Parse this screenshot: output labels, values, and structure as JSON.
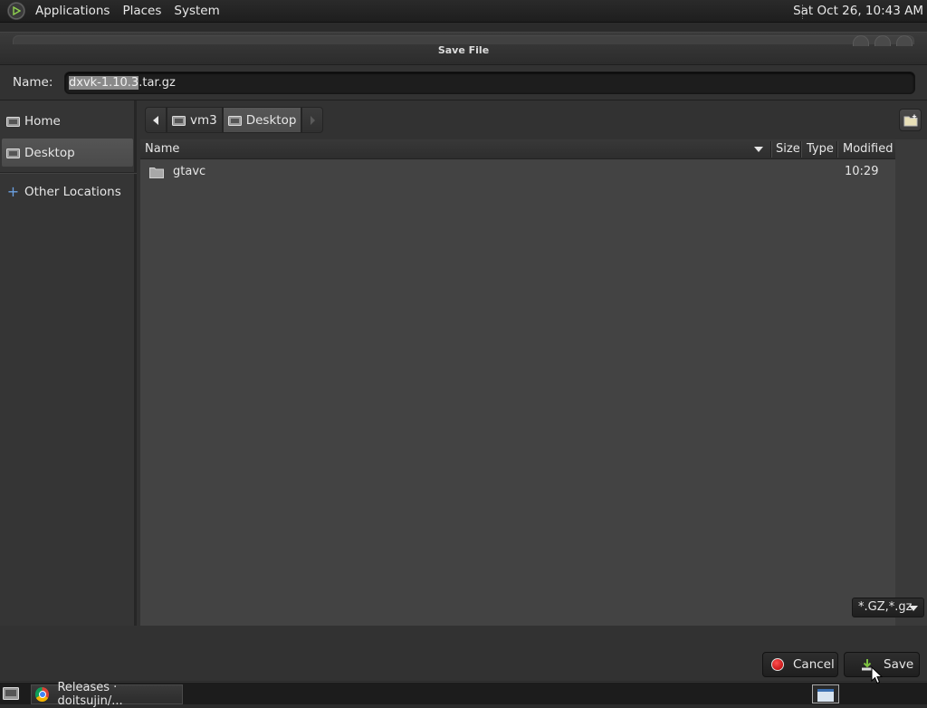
{
  "top_panel": {
    "menus": [
      "Applications",
      "Places",
      "System"
    ],
    "clock": "Sat Oct 26, 10:43 AM"
  },
  "dialog": {
    "title": "Save File",
    "name_label": "Name:",
    "name_value_selected": "dxvk-1.10.3",
    "name_value_rest": ".tar.gz",
    "sidebar": [
      {
        "label": "Home",
        "icon": "drive-icon"
      },
      {
        "label": "Desktop",
        "icon": "drive-icon",
        "active": true
      },
      {
        "label": "Other Locations",
        "icon": "plus-icon"
      }
    ],
    "path": [
      "vm3",
      "Desktop"
    ],
    "columns": {
      "name": "Name",
      "size": "Size",
      "type": "Type",
      "modified": "Modified"
    },
    "files": [
      {
        "name": "gtavc",
        "size": "",
        "type": "",
        "modified": "10:29",
        "icon": "folder-icon"
      }
    ],
    "filter": "*.GZ,*.gz",
    "cancel_label": "Cancel",
    "save_label": "Save"
  },
  "taskbar": {
    "task_label": "Releases · doitsujin/..."
  }
}
